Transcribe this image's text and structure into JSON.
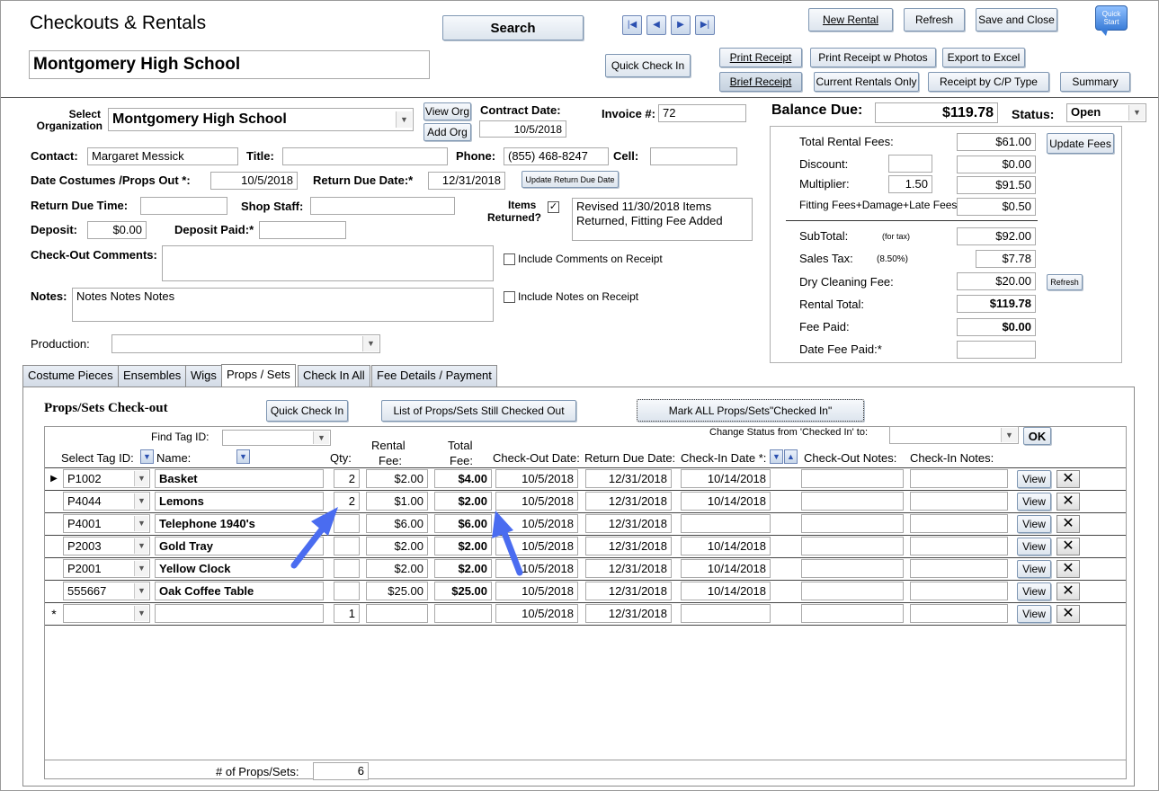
{
  "header": {
    "form_title": "Checkouts & Rentals",
    "org_name": "Montgomery High School",
    "search_label": "Search",
    "quick_check_in_label": "Quick Check In",
    "new_rental_label": "New Rental",
    "refresh_label": "Refresh",
    "save_close_label": "Save and Close",
    "quick_start_label": "Quick Start",
    "print_receipt_label": "Print Receipt",
    "print_receipt_photos_label": "Print Receipt w Photos",
    "export_excel_label": "Export to Excel",
    "brief_receipt_label": "Brief Receipt",
    "current_rentals_label": "Current Rentals Only",
    "receipt_cp_label": "Receipt by C/P Type",
    "summary_label": "Summary"
  },
  "details": {
    "select_org_label": "Select",
    "select_org_label2": "Organization",
    "org_value": "Montgomery High School",
    "view_org_label": "View Org",
    "add_org_label": "Add Org",
    "contract_date_label": "Contract Date:",
    "contract_date_value": "10/5/2018",
    "invoice_label": "Invoice #:",
    "invoice_value": "72",
    "contact_label": "Contact:",
    "contact_value": "Margaret Messick",
    "title_label": "Title:",
    "title_value": "",
    "phone_label": "Phone:",
    "phone_value": "(855) 468-8247",
    "cell_label": "Cell:",
    "cell_value": "",
    "date_out_label": "Date Costumes /Props Out *:",
    "date_out_value": "10/5/2018",
    "return_due_label": "Return Due Date:*",
    "return_due_value": "12/31/2018",
    "update_return_label": "Update Return Due Date",
    "return_time_label": "Return Due Time:",
    "return_time_value": "",
    "shop_staff_label": "Shop Staff:",
    "shop_staff_value": "",
    "items_returned_label": "Items",
    "items_returned_label2": "Returned?",
    "items_returned_checked": "✓",
    "revised_note_line1": "Revised 11/30/2018  Items",
    "revised_note_line2": "Returned, Fitting Fee Added",
    "deposit_label": "Deposit:",
    "deposit_value": "$0.00",
    "deposit_paid_label": "Deposit Paid:*",
    "deposit_paid_value": "",
    "checkout_comments_label": "Check-Out Comments:",
    "checkout_comments_value": "",
    "include_comments_label": "Include Comments on Receipt",
    "notes_label": "Notes:",
    "notes_value": "Notes Notes Notes",
    "include_notes_label": "Include Notes on Receipt",
    "production_label": "Production:",
    "production_value": ""
  },
  "balance": {
    "balance_due_label": "Balance Due:",
    "balance_due_value": "$119.78",
    "status_label": "Status:",
    "status_value": "Open",
    "total_rental_label": "Total Rental Fees:",
    "total_rental_value": "$61.00",
    "update_fees_label": "Update Fees",
    "discount_label": "Discount:",
    "discount_input": "",
    "discount_value": "$0.00",
    "multiplier_label": "Multiplier:",
    "multiplier_input": "1.50",
    "multiplier_value": "$91.50",
    "fitting_label": "Fitting Fees+Damage+Late Fees:",
    "fitting_value": "$0.50",
    "subtotal_label": "SubTotal:",
    "subtotal_note": "(for tax)",
    "subtotal_value": "$92.00",
    "sales_tax_label": "Sales Tax:",
    "sales_tax_rate": "(8.50%)",
    "sales_tax_value": "$7.78",
    "dry_clean_label": "Dry Cleaning Fee:",
    "dry_clean_value": "$20.00",
    "refresh_small_label": "Refresh",
    "rental_total_label": "Rental Total:",
    "rental_total_value": "$119.78",
    "fee_paid_label": "Fee Paid:",
    "fee_paid_value": "$0.00",
    "date_fee_paid_label": "Date Fee Paid:*",
    "date_fee_paid_value": ""
  },
  "tabs": [
    "Costume Pieces",
    "Ensembles",
    "Wigs",
    "Props / Sets",
    "Check In All",
    "Fee Details / Payment"
  ],
  "props": {
    "section_title": "Props/Sets Check-out",
    "quick_check_in_label": "Quick Check In",
    "still_out_label": "List of Props/Sets Still Checked Out",
    "mark_all_label": "Mark ALL Props/Sets\"Checked In\"",
    "find_tag_label": "Find Tag ID:",
    "change_status_label": "Change Status from 'Checked In'  to:",
    "ok_label": "OK",
    "col_tag": "Select Tag ID:",
    "col_name": "Name:",
    "col_qty": "Qty:",
    "col_rental_1": "Rental",
    "col_rental_2": "Fee:",
    "col_total_1": "Total",
    "col_total_2": "Fee:",
    "col_checkout": "Check-Out Date:",
    "col_return": "Return Due Date:",
    "col_checkin": "Check-In Date *:",
    "col_co_notes": "Check-Out Notes:",
    "col_ci_notes": "Check-In Notes:",
    "view_label": "View",
    "delete_label": "✕",
    "new_row_marker": "*",
    "current_row_marker": "▶",
    "count_label": "# of Props/Sets:",
    "count_value": "6",
    "rows": [
      {
        "tag": "P1002",
        "name": "Basket",
        "qty": "2",
        "rental": "$2.00",
        "total": "$4.00",
        "out": "10/5/2018",
        "due": "12/31/2018",
        "in": "10/14/2018"
      },
      {
        "tag": "P4044",
        "name": "Lemons",
        "qty": "2",
        "rental": "$1.00",
        "total": "$2.00",
        "out": "10/5/2018",
        "due": "12/31/2018",
        "in": "10/14/2018"
      },
      {
        "tag": "P4001",
        "name": "Telephone 1940's",
        "qty": "",
        "rental": "$6.00",
        "total": "$6.00",
        "out": "10/5/2018",
        "due": "12/31/2018",
        "in": ""
      },
      {
        "tag": "P2003",
        "name": "Gold Tray",
        "qty": "",
        "rental": "$2.00",
        "total": "$2.00",
        "out": "10/5/2018",
        "due": "12/31/2018",
        "in": "10/14/2018"
      },
      {
        "tag": "P2001",
        "name": "Yellow Clock",
        "qty": "",
        "rental": "$2.00",
        "total": "$2.00",
        "out": "10/5/2018",
        "due": "12/31/2018",
        "in": "10/14/2018"
      },
      {
        "tag": "555667",
        "name": "Oak Coffee Table",
        "qty": "",
        "rental": "$25.00",
        "total": "$25.00",
        "out": "10/5/2018",
        "due": "12/31/2018",
        "in": "10/14/2018"
      },
      {
        "tag": "",
        "name": "",
        "qty": "1",
        "rental": "",
        "total": "",
        "out": "10/5/2018",
        "due": "12/31/2018",
        "in": ""
      }
    ]
  },
  "colors": {
    "button_border": "#7f97b3",
    "nav_blue": "#2b50b0",
    "arrow_blue": "#4a6cf0"
  }
}
